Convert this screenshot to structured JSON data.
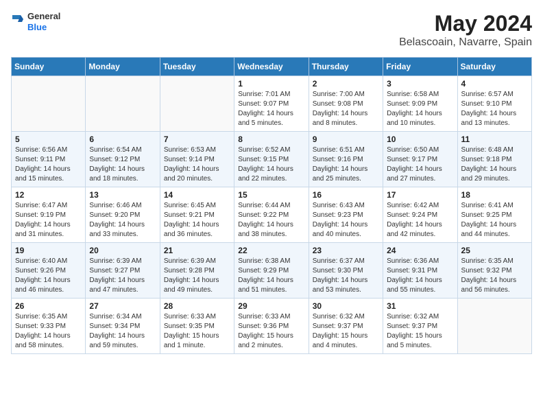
{
  "header": {
    "logo_line1": "General",
    "logo_line2": "Blue",
    "title": "May 2024",
    "subtitle": "Belascoain, Navarre, Spain"
  },
  "days_of_week": [
    "Sunday",
    "Monday",
    "Tuesday",
    "Wednesday",
    "Thursday",
    "Friday",
    "Saturday"
  ],
  "weeks": [
    [
      {
        "day": "",
        "info": ""
      },
      {
        "day": "",
        "info": ""
      },
      {
        "day": "",
        "info": ""
      },
      {
        "day": "1",
        "info": "Sunrise: 7:01 AM\nSunset: 9:07 PM\nDaylight: 14 hours\nand 5 minutes."
      },
      {
        "day": "2",
        "info": "Sunrise: 7:00 AM\nSunset: 9:08 PM\nDaylight: 14 hours\nand 8 minutes."
      },
      {
        "day": "3",
        "info": "Sunrise: 6:58 AM\nSunset: 9:09 PM\nDaylight: 14 hours\nand 10 minutes."
      },
      {
        "day": "4",
        "info": "Sunrise: 6:57 AM\nSunset: 9:10 PM\nDaylight: 14 hours\nand 13 minutes."
      }
    ],
    [
      {
        "day": "5",
        "info": "Sunrise: 6:56 AM\nSunset: 9:11 PM\nDaylight: 14 hours\nand 15 minutes."
      },
      {
        "day": "6",
        "info": "Sunrise: 6:54 AM\nSunset: 9:12 PM\nDaylight: 14 hours\nand 18 minutes."
      },
      {
        "day": "7",
        "info": "Sunrise: 6:53 AM\nSunset: 9:14 PM\nDaylight: 14 hours\nand 20 minutes."
      },
      {
        "day": "8",
        "info": "Sunrise: 6:52 AM\nSunset: 9:15 PM\nDaylight: 14 hours\nand 22 minutes."
      },
      {
        "day": "9",
        "info": "Sunrise: 6:51 AM\nSunset: 9:16 PM\nDaylight: 14 hours\nand 25 minutes."
      },
      {
        "day": "10",
        "info": "Sunrise: 6:50 AM\nSunset: 9:17 PM\nDaylight: 14 hours\nand 27 minutes."
      },
      {
        "day": "11",
        "info": "Sunrise: 6:48 AM\nSunset: 9:18 PM\nDaylight: 14 hours\nand 29 minutes."
      }
    ],
    [
      {
        "day": "12",
        "info": "Sunrise: 6:47 AM\nSunset: 9:19 PM\nDaylight: 14 hours\nand 31 minutes."
      },
      {
        "day": "13",
        "info": "Sunrise: 6:46 AM\nSunset: 9:20 PM\nDaylight: 14 hours\nand 33 minutes."
      },
      {
        "day": "14",
        "info": "Sunrise: 6:45 AM\nSunset: 9:21 PM\nDaylight: 14 hours\nand 36 minutes."
      },
      {
        "day": "15",
        "info": "Sunrise: 6:44 AM\nSunset: 9:22 PM\nDaylight: 14 hours\nand 38 minutes."
      },
      {
        "day": "16",
        "info": "Sunrise: 6:43 AM\nSunset: 9:23 PM\nDaylight: 14 hours\nand 40 minutes."
      },
      {
        "day": "17",
        "info": "Sunrise: 6:42 AM\nSunset: 9:24 PM\nDaylight: 14 hours\nand 42 minutes."
      },
      {
        "day": "18",
        "info": "Sunrise: 6:41 AM\nSunset: 9:25 PM\nDaylight: 14 hours\nand 44 minutes."
      }
    ],
    [
      {
        "day": "19",
        "info": "Sunrise: 6:40 AM\nSunset: 9:26 PM\nDaylight: 14 hours\nand 46 minutes."
      },
      {
        "day": "20",
        "info": "Sunrise: 6:39 AM\nSunset: 9:27 PM\nDaylight: 14 hours\nand 47 minutes."
      },
      {
        "day": "21",
        "info": "Sunrise: 6:39 AM\nSunset: 9:28 PM\nDaylight: 14 hours\nand 49 minutes."
      },
      {
        "day": "22",
        "info": "Sunrise: 6:38 AM\nSunset: 9:29 PM\nDaylight: 14 hours\nand 51 minutes."
      },
      {
        "day": "23",
        "info": "Sunrise: 6:37 AM\nSunset: 9:30 PM\nDaylight: 14 hours\nand 53 minutes."
      },
      {
        "day": "24",
        "info": "Sunrise: 6:36 AM\nSunset: 9:31 PM\nDaylight: 14 hours\nand 55 minutes."
      },
      {
        "day": "25",
        "info": "Sunrise: 6:35 AM\nSunset: 9:32 PM\nDaylight: 14 hours\nand 56 minutes."
      }
    ],
    [
      {
        "day": "26",
        "info": "Sunrise: 6:35 AM\nSunset: 9:33 PM\nDaylight: 14 hours\nand 58 minutes."
      },
      {
        "day": "27",
        "info": "Sunrise: 6:34 AM\nSunset: 9:34 PM\nDaylight: 14 hours\nand 59 minutes."
      },
      {
        "day": "28",
        "info": "Sunrise: 6:33 AM\nSunset: 9:35 PM\nDaylight: 15 hours\nand 1 minute."
      },
      {
        "day": "29",
        "info": "Sunrise: 6:33 AM\nSunset: 9:36 PM\nDaylight: 15 hours\nand 2 minutes."
      },
      {
        "day": "30",
        "info": "Sunrise: 6:32 AM\nSunset: 9:37 PM\nDaylight: 15 hours\nand 4 minutes."
      },
      {
        "day": "31",
        "info": "Sunrise: 6:32 AM\nSunset: 9:37 PM\nDaylight: 15 hours\nand 5 minutes."
      },
      {
        "day": "",
        "info": ""
      }
    ]
  ]
}
